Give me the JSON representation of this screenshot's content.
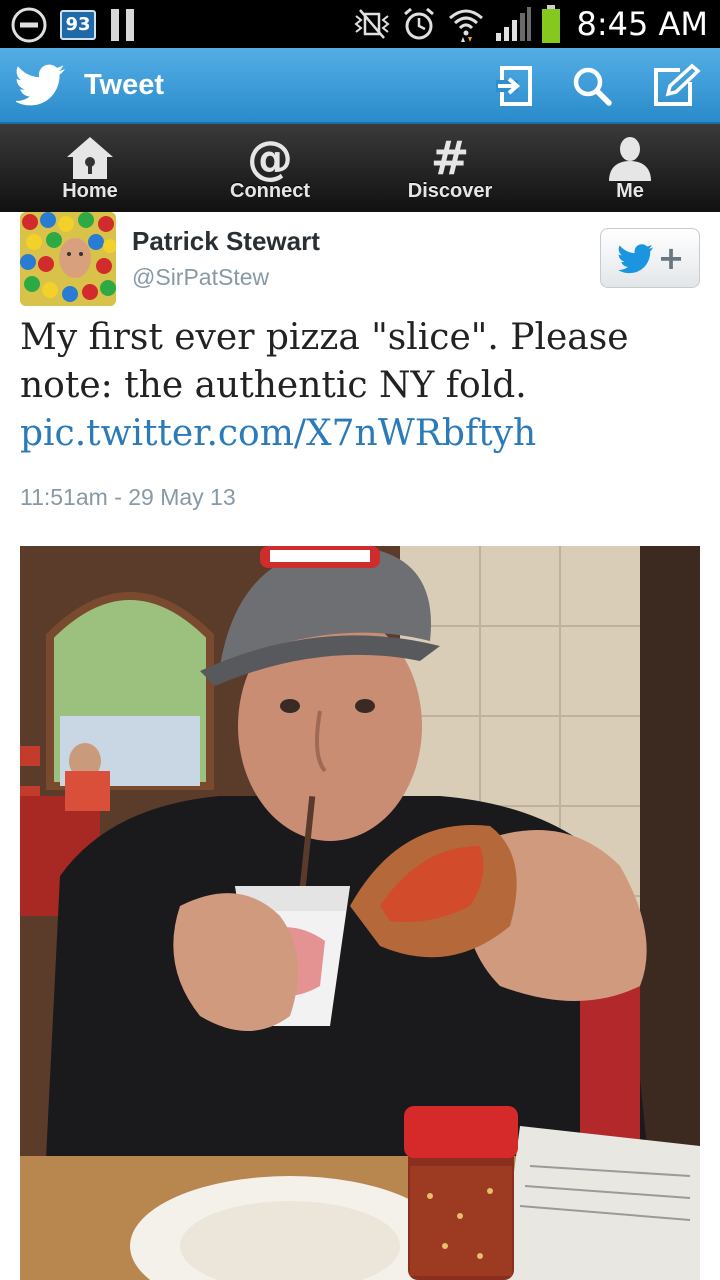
{
  "status_bar": {
    "time": "8:45 AM",
    "badge_number": "93",
    "icons": [
      "do-not-disturb-icon",
      "notification-badge",
      "pause-icon",
      "vibrate-icon",
      "alarm-icon",
      "wifi-icon",
      "signal-icon",
      "battery-icon"
    ]
  },
  "action_bar": {
    "title": "Tweet",
    "buttons": [
      "sign-in-icon",
      "search-icon",
      "compose-icon"
    ],
    "color": "#3a9bd8"
  },
  "tabs": [
    {
      "label": "Home",
      "icon": "home-icon"
    },
    {
      "label": "Connect",
      "icon": "at-icon"
    },
    {
      "label": "Discover",
      "icon": "hashtag-icon"
    },
    {
      "label": "Me",
      "icon": "profile-icon"
    }
  ],
  "tweet": {
    "author_name": "Patrick Stewart",
    "handle": "@SirPatStew",
    "text": "My first ever pizza \"slice\". Please note: the authentic NY fold.",
    "link": "pic.twitter.com/X7nWRbftyh",
    "timestamp": "11:51am - 29 May 13",
    "follow_button_icon": "follow-icon",
    "link_color": "#2b7bb9"
  }
}
